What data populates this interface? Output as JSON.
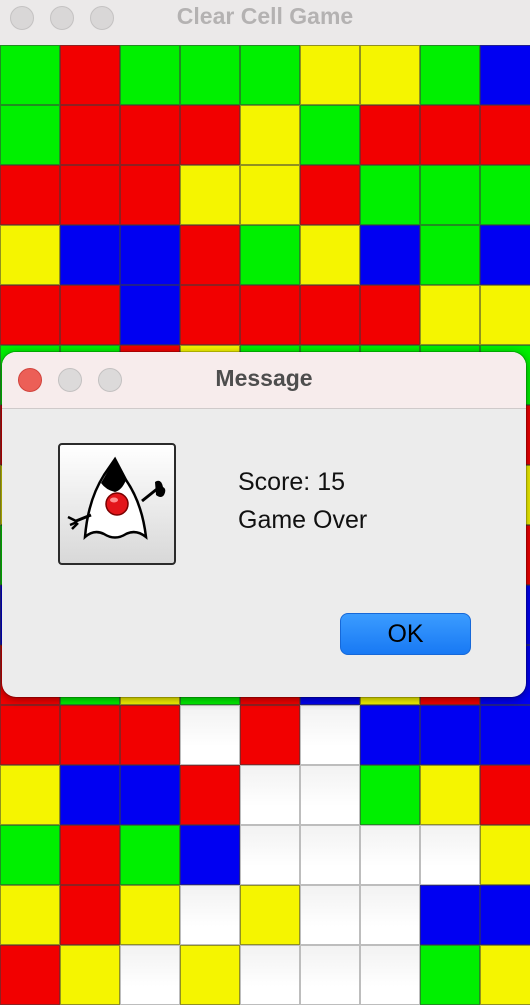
{
  "window": {
    "title": "Clear Cell Game"
  },
  "board": {
    "rows": [
      [
        "g",
        "r",
        "g",
        "g",
        "g",
        "y",
        "y",
        "g",
        "b"
      ],
      [
        "g",
        "r",
        "r",
        "r",
        "y",
        "g",
        "r",
        "r",
        "r"
      ],
      [
        "r",
        "r",
        "r",
        "y",
        "y",
        "r",
        "g",
        "g",
        "g"
      ],
      [
        "y",
        "b",
        "b",
        "r",
        "g",
        "y",
        "b",
        "g",
        "b"
      ],
      [
        "r",
        "r",
        "b",
        "r",
        "r",
        "r",
        "r",
        "y",
        "y"
      ],
      [
        "g",
        "g",
        "r",
        "y",
        "g",
        "g",
        "g",
        "g",
        "g"
      ],
      [
        "r",
        "y",
        "g",
        "r",
        "b",
        "y",
        "r",
        "y",
        "r"
      ],
      [
        "y",
        "g",
        "r",
        "b",
        "r",
        "b",
        "y",
        "g",
        "y"
      ],
      [
        "g",
        "r",
        "b",
        "g",
        "y",
        "r",
        "g",
        "b",
        "r"
      ],
      [
        "b",
        "y",
        "y",
        "r",
        "g",
        "b",
        "r",
        "g",
        "b"
      ],
      [
        "r",
        "g",
        "y",
        "g",
        "r",
        "b",
        "y",
        "r",
        "b"
      ],
      [
        "r",
        "r",
        "r",
        "w",
        "r",
        "w",
        "b",
        "b",
        "b"
      ],
      [
        "y",
        "b",
        "b",
        "r",
        "w",
        "w",
        "g",
        "y",
        "r"
      ],
      [
        "g",
        "r",
        "g",
        "b",
        "w",
        "w",
        "w",
        "w",
        "y"
      ],
      [
        "y",
        "r",
        "y",
        "w",
        "y",
        "w",
        "w",
        "b",
        "b"
      ],
      [
        "r",
        "y",
        "w",
        "y",
        "w",
        "w",
        "w",
        "g",
        "y"
      ]
    ],
    "colors": {
      "g": "#00f000",
      "r": "#f20000",
      "y": "#f5f500",
      "b": "#0000f2",
      "w": "#ffffff"
    }
  },
  "dialog": {
    "title": "Message",
    "icon": "duke-icon",
    "score_text": "Score: 15",
    "status_text": "Game Over",
    "ok_label": "OK",
    "accent": "#1a7ff5"
  }
}
